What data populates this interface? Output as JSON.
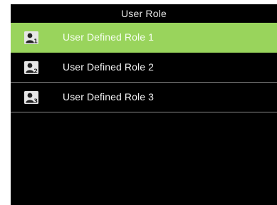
{
  "header": {
    "title": "User Role"
  },
  "roles": [
    {
      "label": "User Defined Role 1",
      "number": "1",
      "icon": "user-role-1-icon",
      "selected": true
    },
    {
      "label": "User Defined Role 2",
      "number": "2",
      "icon": "user-role-2-icon",
      "selected": false
    },
    {
      "label": "User Defined Role 3",
      "number": "3",
      "icon": "user-role-3-icon",
      "selected": false
    }
  ],
  "colors": {
    "background": "#000000",
    "selected_row": "#99d45c",
    "separator": "#8a8a8a",
    "text": "#f2f2f2",
    "icon_tile": "#e6e6e6"
  }
}
